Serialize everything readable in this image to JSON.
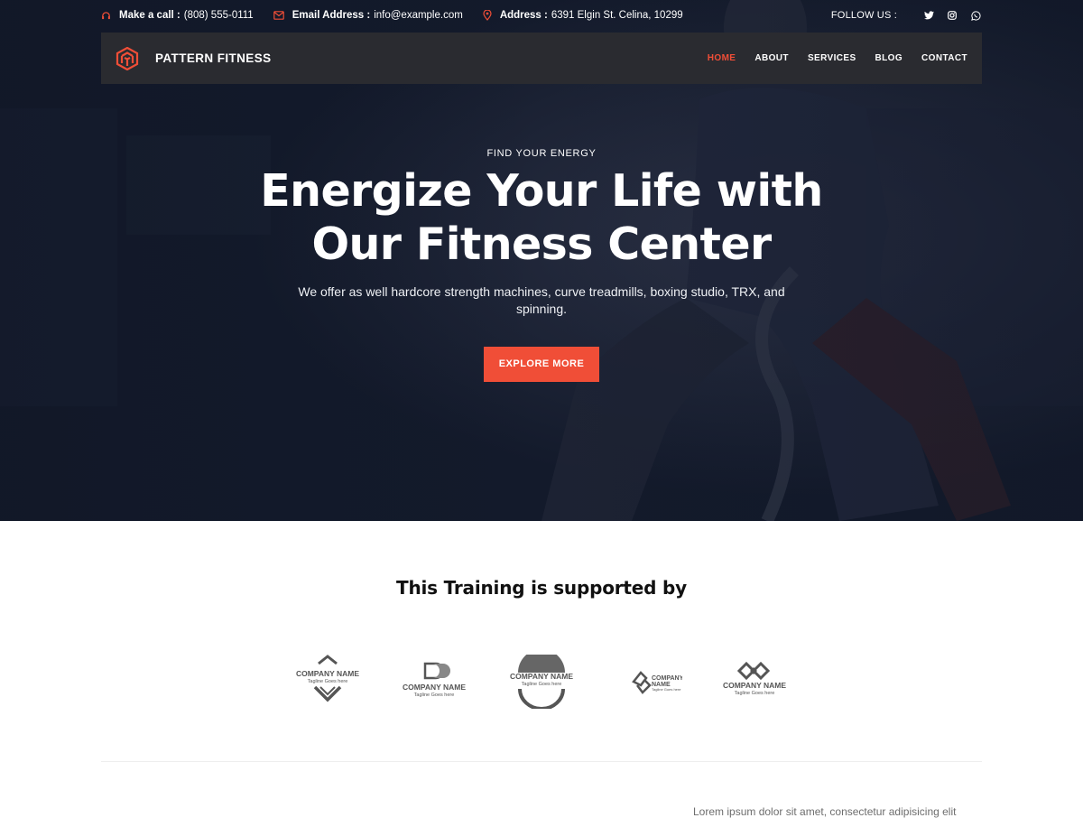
{
  "topbar": {
    "phone": {
      "label": "Make a call :",
      "value": "(808) 555-0111",
      "icon": "headset-icon"
    },
    "email": {
      "label": "Email Address :",
      "value": "info@example.com",
      "icon": "mail-icon"
    },
    "address": {
      "label": "Address :",
      "value": "6391 Elgin St. Celina, 10299",
      "icon": "map-pin-icon"
    },
    "follow_label": "FOLLOW US :",
    "social": [
      "twitter-icon",
      "instagram-icon",
      "whatsapp-icon"
    ]
  },
  "navbar": {
    "brand": "PATTERN FITNESS",
    "items": [
      {
        "label": "HOME",
        "active": true
      },
      {
        "label": "ABOUT",
        "active": false
      },
      {
        "label": "SERVICES",
        "active": false
      },
      {
        "label": "BLOG",
        "active": false
      },
      {
        "label": "CONTACT",
        "active": false
      }
    ]
  },
  "hero": {
    "eyebrow": "FIND YOUR ENERGY",
    "headline_line1": "Energize Your Life with",
    "headline_line2": "Our Fitness Center",
    "subtext": "We offer as well hardcore strength machines, curve treadmills, boxing studio, TRX, and spinning.",
    "cta": "EXPLORE MORE"
  },
  "sponsors": {
    "title": "This Training is supported by",
    "logos": [
      {
        "name": "COMPANY NAME",
        "tagline": "Tagline Goes here"
      },
      {
        "name": "COMPANY NAME",
        "tagline": "Tagline Goes here"
      },
      {
        "name": "COMPANY NAME",
        "tagline": "Tagline Goes here"
      },
      {
        "name": "COMPANY NAME",
        "tagline": "Tagline Goes here"
      },
      {
        "name": "COMPANY NAME",
        "tagline": "Tagline Goes here"
      }
    ]
  },
  "footer_preview": {
    "text": "Lorem ipsum dolor sit amet, consectetur adipisicing elit"
  },
  "colors": {
    "accent": "#f04e37",
    "nav_bg": "#2a2b30",
    "hero_bg": "#131a2b",
    "logo_gray": "#555555"
  }
}
